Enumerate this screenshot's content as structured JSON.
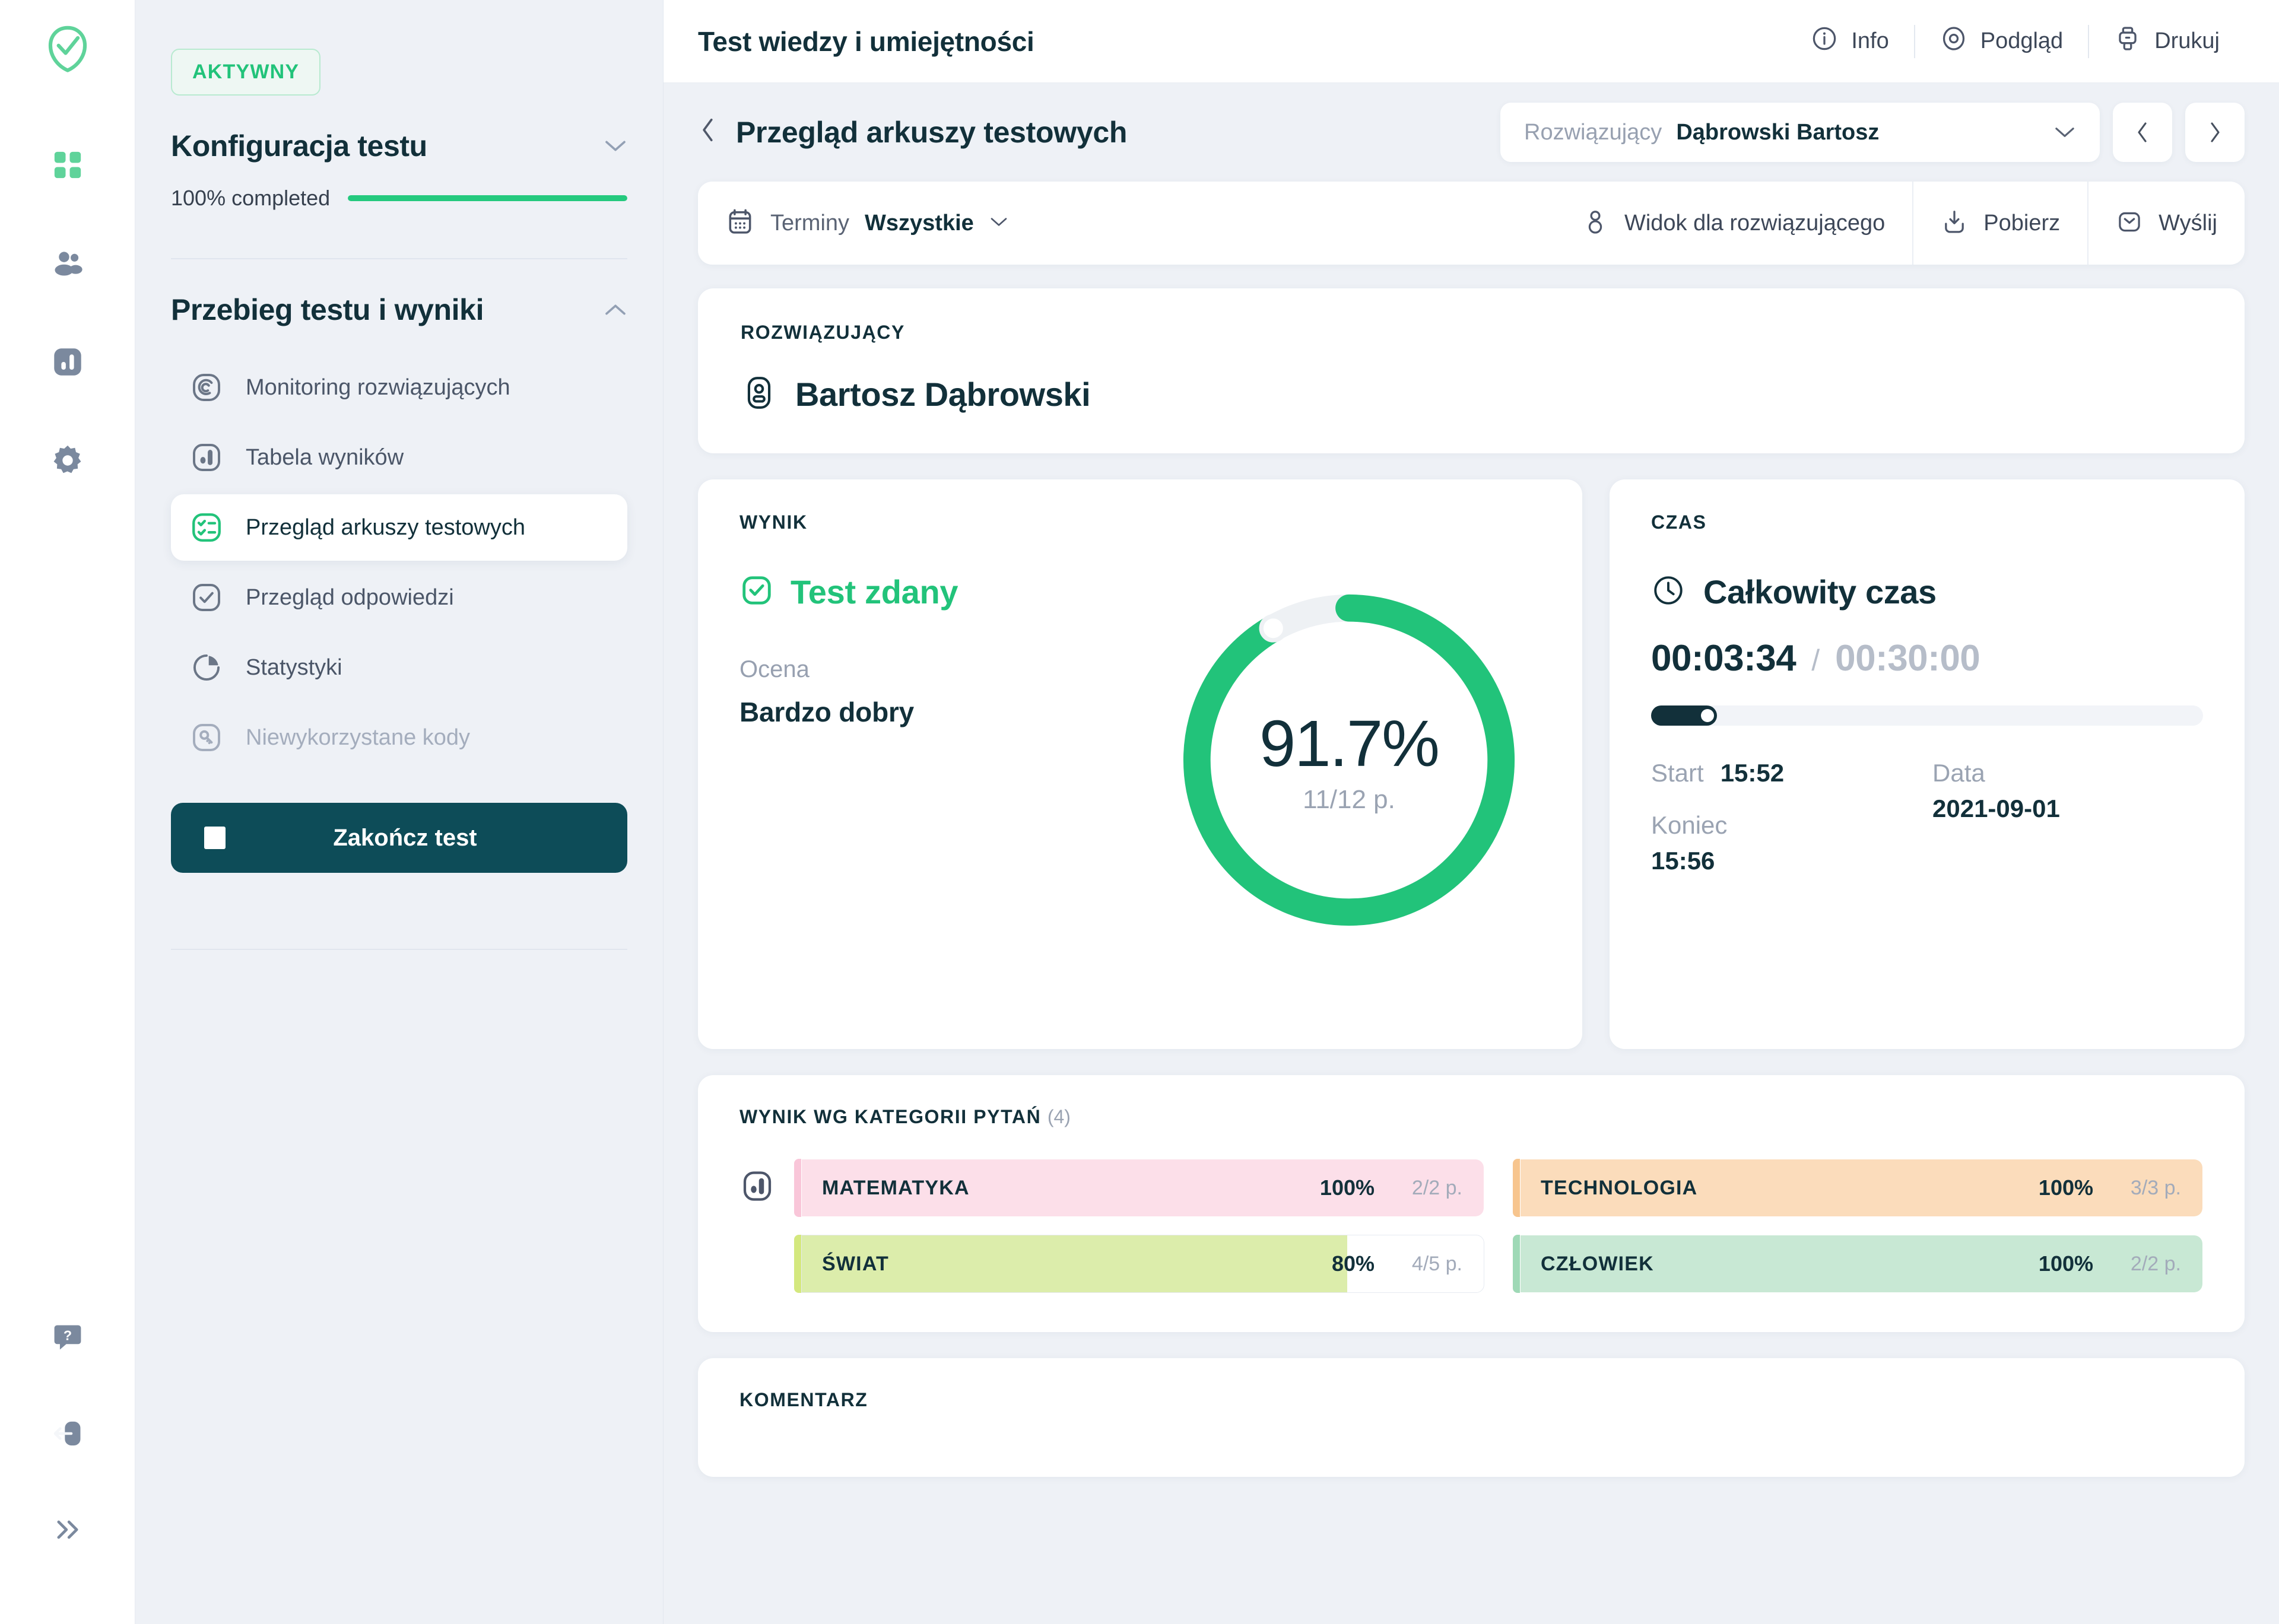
{
  "topbar": {
    "title": "Test wiedzy i umiejętności",
    "actions": [
      {
        "label": "Info",
        "icon": "info-circle-icon"
      },
      {
        "label": "Podgląd",
        "icon": "eye-target-icon"
      },
      {
        "label": "Drukuj",
        "icon": "printer-icon"
      }
    ]
  },
  "rail": {
    "logo": "checkmark-leaf-logo",
    "items": [
      {
        "icon": "grid-dashboard-icon",
        "active": true
      },
      {
        "icon": "users-group-icon",
        "active": false
      },
      {
        "icon": "bar-chart-icon",
        "active": false
      },
      {
        "icon": "gear-settings-icon",
        "active": false
      }
    ],
    "bottom": [
      {
        "icon": "help-question-icon"
      },
      {
        "icon": "logout-icon"
      },
      {
        "icon": "expand-chevrons-icon"
      }
    ]
  },
  "panel": {
    "status_badge": "AKTYWNY",
    "config": {
      "title": "Konfiguracja testu",
      "chevron": "chevron-down-icon",
      "progress_label": "100% completed",
      "progress_percent": 100
    },
    "results": {
      "title": "Przebieg testu i wyniki",
      "chevron": "chevron-up-icon",
      "items": [
        {
          "label": "Monitoring rozwiązujących",
          "icon": "monitoring-icon",
          "state": "normal"
        },
        {
          "label": "Tabela wyników",
          "icon": "results-table-icon",
          "state": "normal"
        },
        {
          "label": "Przegląd arkuszy testowych",
          "icon": "test-sheets-icon",
          "state": "active"
        },
        {
          "label": "Przegląd odpowiedzi",
          "icon": "answers-check-icon",
          "state": "normal"
        },
        {
          "label": "Statystyki",
          "icon": "pie-chart-icon",
          "state": "normal"
        },
        {
          "label": "Niewykorzystane kody",
          "icon": "unused-codes-icon",
          "state": "muted"
        }
      ]
    },
    "end_test_button": "Zakończ test"
  },
  "breadcrumb": {
    "back_icon": "chevron-left-icon",
    "title": "Przegląd arkuszy testowych",
    "solver_select": {
      "label": "Rozwiązujący",
      "value": "Dąbrowski Bartosz",
      "caret": "chevron-down-icon"
    },
    "prev": "chevron-left-icon",
    "next": "chevron-right-icon"
  },
  "toolbar": {
    "terminy_icon": "calendar-icon",
    "terminy_label": "Terminy",
    "terminy_value": "Wszystkie",
    "terminy_caret": "chevron-down-icon",
    "view_icon": "person-icon",
    "view_label": "Widok dla rozwiązującego",
    "download_icon": "download-icon",
    "download_label": "Pobierz",
    "send_icon": "send-envelope-icon",
    "send_label": "Wyślij"
  },
  "solver_card": {
    "label": "ROZWIĄZUJĄCY",
    "avatar_icon": "user-badge-icon",
    "name": "Bartosz Dąbrowski"
  },
  "result_card": {
    "label": "WYNIK",
    "pass_icon": "check-square-icon",
    "pass_text": "Test zdany",
    "grade_label": "Ocena",
    "grade_value": "Bardzo dobry"
  },
  "time_card": {
    "label": "CZAS",
    "clock_icon": "clock-icon",
    "title": "Całkowity czas",
    "elapsed": "00:03:34",
    "separator": "/",
    "limit": "00:30:00",
    "progress_percent": 11.9,
    "start_label": "Start",
    "start_value": "15:52",
    "end_label": "Koniec",
    "end_value": "15:56",
    "date_label": "Data",
    "date_value": "2021-09-01"
  },
  "categories_card": {
    "label": "WYNIK WG KATEGORII PYTAŃ",
    "count": "(4)",
    "icon": "bar-chart-small-icon"
  },
  "comment_card": {
    "label": "KOMENTARZ"
  },
  "colors": {
    "brand_green": "#22c37a",
    "dark": "#12303a",
    "muted": "#9aa3b2",
    "page_bg": "#eef1f6"
  },
  "chart_data": [
    {
      "type": "pie",
      "title": "Wynik",
      "center_value": "91.7%",
      "center_sub": "11/12 p.",
      "percent": 91.7,
      "points_earned": 11,
      "points_total": 12,
      "track_color": "#eef1f4",
      "fill_color": "#22c37a"
    },
    {
      "type": "bar",
      "title": "WYNIK WG KATEGORII PYTAŃ",
      "orientation": "horizontal",
      "xlabel": "",
      "ylabel": "",
      "xlim": [
        0,
        100
      ],
      "categories": [
        "MATEMATYKA",
        "TECHNOLOGIA",
        "ŚWIAT",
        "CZŁOWIEK"
      ],
      "values": [
        100,
        100,
        80,
        100
      ],
      "items": [
        {
          "name": "MATEMATYKA",
          "percent_label": "100%",
          "percent": 100,
          "points": "2/2 p.",
          "accent": "#f9c6d9",
          "fill": "#fcdfe9"
        },
        {
          "name": "TECHNOLOGIA",
          "percent_label": "100%",
          "percent": 100,
          "points": "3/3 p.",
          "accent": "#f7c58e",
          "fill": "#fbdcbb"
        },
        {
          "name": "ŚWIAT",
          "percent_label": "80%",
          "percent": 80,
          "points": "4/5 p.",
          "accent": "#d4e87e",
          "fill": "#dcedab"
        },
        {
          "name": "CZŁOWIEK",
          "percent_label": "100%",
          "percent": 100,
          "points": "2/2 p.",
          "accent": "#9fd9b6",
          "fill": "#c8e8d4"
        }
      ]
    }
  ]
}
